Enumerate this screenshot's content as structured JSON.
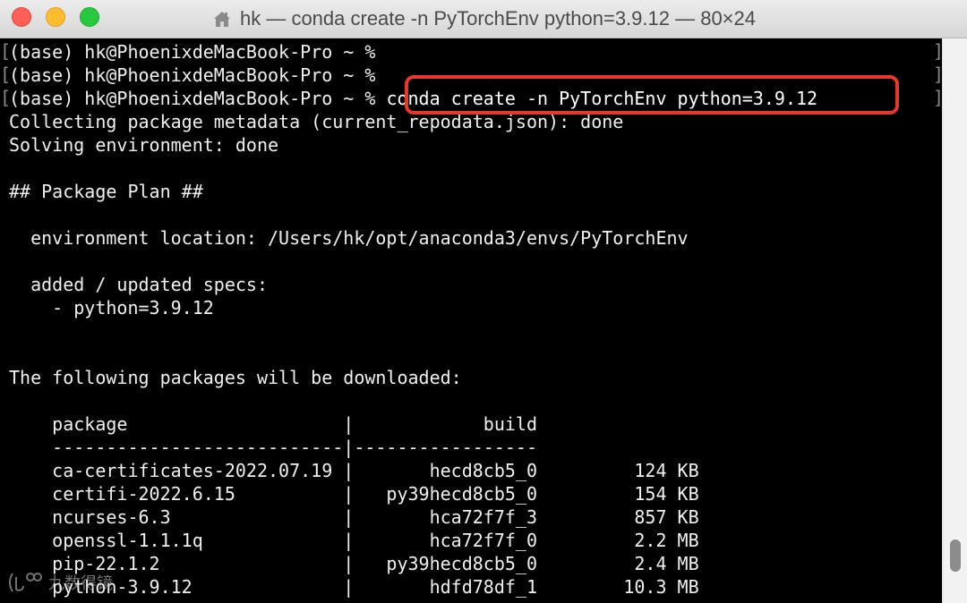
{
  "window": {
    "title": "hk — conda create -n PyTorchEnv python=3.9.12 — 80×24",
    "folder_icon": "home-folder-icon",
    "controls": [
      "close-button",
      "minimize-button",
      "zoom-button"
    ]
  },
  "terminal": {
    "prompt_lines": [
      {
        "prompt": "(base) hk@PhoenixdeMacBook-Pro ~ % ",
        "command": ""
      },
      {
        "prompt": "(base) hk@PhoenixdeMacBook-Pro ~ % ",
        "command": ""
      },
      {
        "prompt": "(base) hk@PhoenixdeMacBook-Pro ~ % ",
        "command": "conda create -n PyTorchEnv python=3.9.12"
      }
    ],
    "output": {
      "collecting": "Collecting package metadata (current_repodata.json): done",
      "solving": "Solving environment: done",
      "plan_header": "## Package Plan ##",
      "env_location": "  environment location: /Users/hk/opt/anaconda3/envs/PyTorchEnv",
      "specs_header": "  added / updated specs:",
      "spec_item": "    - python=3.9.12",
      "download_header": "The following packages will be downloaded:"
    },
    "table": {
      "header": "    package                    |            build",
      "divider": "    ---------------------------|-----------------",
      "rows": [
        "    ca-certificates-2022.07.19 |       hecd8cb5_0         124 KB",
        "    certifi-2022.6.15          |   py39hecd8cb5_0         154 KB",
        "    ncurses-6.3                |       hca72f7f_3         857 KB",
        "    openssl-1.1.1q             |       hca72f7f_0         2.2 MB",
        "    pip-22.1.2                 |   py39hecd8cb5_0         2.4 MB",
        "    python-3.9.12              |       hdfd78df_1        10.3 MB"
      ]
    },
    "highlight_color": "#e8382b"
  },
  "watermark": {
    "text": "九数得镜",
    "logo": "watermark-logo-icon"
  }
}
